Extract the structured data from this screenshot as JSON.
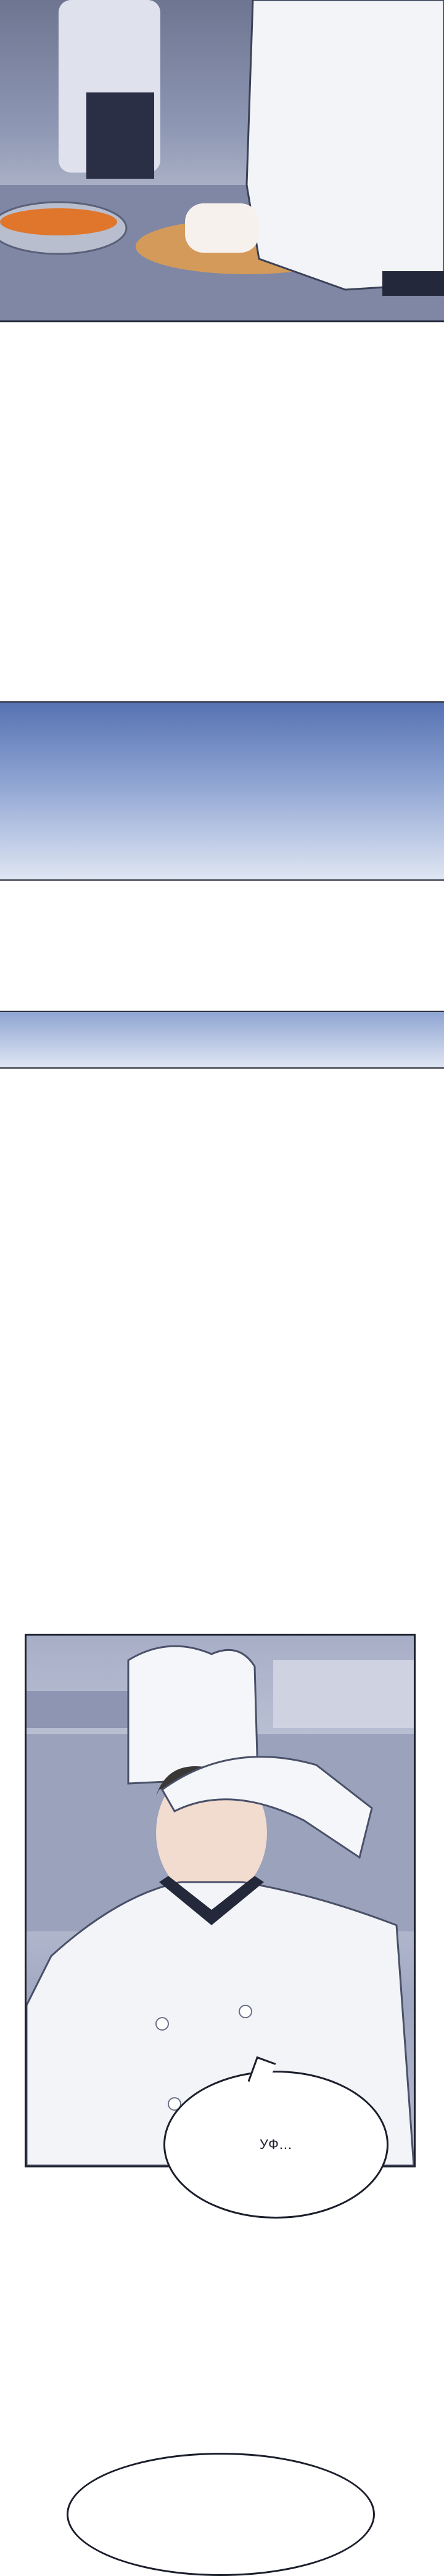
{
  "scene": {
    "bubble_main_text": "УФ..."
  },
  "colors": {
    "panel_border": "#1b1f2b",
    "sky_blue": "#5672b2",
    "chef_coat": "#f3f4f8",
    "chef_collar": "#23283a",
    "carrot": "#e0762b"
  }
}
